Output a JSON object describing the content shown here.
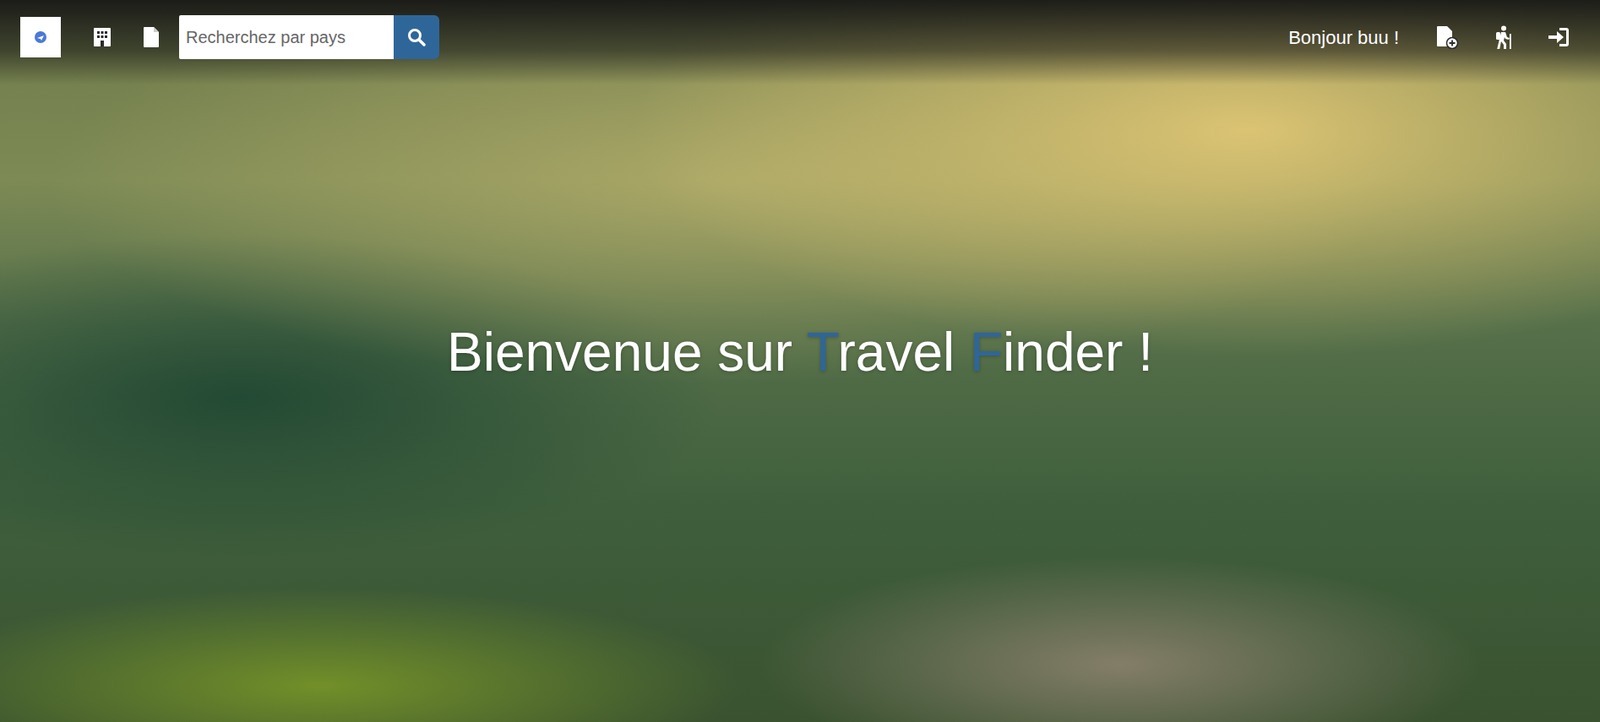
{
  "navbar": {
    "search": {
      "placeholder": "Recherchez par pays"
    },
    "greeting": "Bonjour buu !"
  },
  "hero": {
    "title": [
      {
        "text": "Bienvenue sur ",
        "accent": false
      },
      {
        "text": "T",
        "accent": true
      },
      {
        "text": "ravel ",
        "accent": false
      },
      {
        "text": "F",
        "accent": true
      },
      {
        "text": "inder !",
        "accent": false
      }
    ]
  }
}
